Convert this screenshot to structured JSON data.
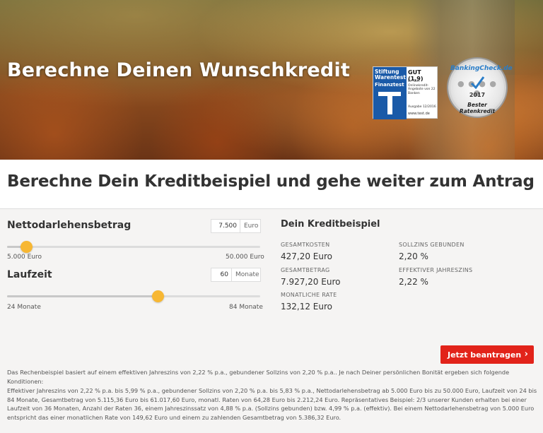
{
  "hero": {
    "title": "Berechne Deinen Wunschkredit",
    "stiftung_warentest": {
      "brand_line1": "Stiftung",
      "brand_line2": "Warentest",
      "brand_line3": "Finanztest",
      "grade": "GUT (1,9)",
      "small_text": "Im Test: Onlinekredit-Angebote von 22 Banken",
      "issue": "Ausgabe 12/2016",
      "url": "www.test.de"
    },
    "bankingcheck": {
      "top": "BankingCheck.de",
      "year": "2017",
      "bottom": "Bester Ratenkredit"
    }
  },
  "band": {
    "title": "Berechne Dein Kreditbeispiel und gehe weiter zum Antrag"
  },
  "calculator": {
    "amount": {
      "label": "Nettodarlehensbetrag",
      "value": "7.500",
      "unit": "Euro",
      "min_label": "5.000 Euro",
      "max_label": "50.000 Euro",
      "min": 5000,
      "max": 50000,
      "current": 7500
    },
    "term": {
      "label": "Laufzeit",
      "value": "60",
      "unit": "Monate",
      "min_label": "24 Monate",
      "max_label": "84 Monate",
      "min": 24,
      "max": 84,
      "current": 60
    }
  },
  "example": {
    "title": "Dein Kreditbeispiel",
    "gesamtkosten_label": "GESAMTKOSTEN",
    "gesamtkosten_value": "427,20 Euro",
    "sollzins_label": "SOLLZINS GEBUNDEN",
    "sollzins_value": "2,20 %",
    "gesamtbetrag_label": "GESAMTBETRAG",
    "gesamtbetrag_value": "7.927,20 Euro",
    "effektiv_label": "EFFEKTIVER JAHRESZINS",
    "effektiv_value": "2,22 %",
    "rate_label": "MONATLICHE RATE",
    "rate_value": "132,12 Euro"
  },
  "cta": {
    "label": "Jetzt beantragen",
    "arrow": "›"
  },
  "fine_print": {
    "p1": "Das Rechenbeispiel basiert auf einem effektiven Jahreszins von 2,22 % p.a., gebundener Sollzins von 2,20 % p.a.. Je nach Deiner persönlichen Bonität ergeben sich folgende Konditionen:",
    "p2": "Effektiver Jahreszins von 2,22 % p.a. bis 5,99 % p.a., gebundener Sollzins von 2,20 % p.a. bis 5,83 % p.a., Nettodarlehensbetrag ab 5.000 Euro bis zu 50.000 Euro, Laufzeit von 24 bis 84 Monate, Gesamtbetrag von 5.115,36 Euro bis 61.017,60 Euro, monatl. Raten von 64,28 Euro bis 2.212,24 Euro. Repräsentatives Beispiel: 2/3 unserer Kunden erhalten bei einer Laufzeit von 36 Monaten, Anzahl der Raten 36, einem Jahreszinssatz von 4,88 % p.a. (Sollzins gebunden) bzw. 4,99 % p.a. (effektiv). Bei einem Nettodarlehensbetrag von 5.000 Euro entspricht das einer monatlichen Rate von 149,62 Euro und einem zu zahlenden Gesamtbetrag von 5.386,32 Euro."
  },
  "colors": {
    "accent": "#e2231a",
    "slider_thumb": "#f7b733"
  }
}
